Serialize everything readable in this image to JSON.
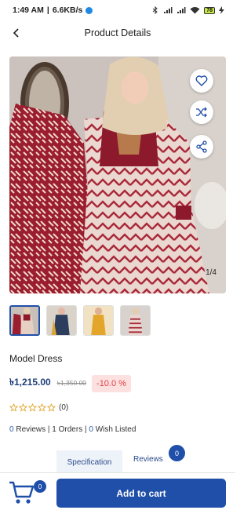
{
  "status_bar": {
    "time": "1:49 AM",
    "speed": "6.6KB/s",
    "battery": "78"
  },
  "header": {
    "title": "Product Details"
  },
  "gallery": {
    "counter": "1/4",
    "thumbnails": [
      {
        "name": "thumbnail-1"
      },
      {
        "name": "thumbnail-2"
      },
      {
        "name": "thumbnail-3"
      },
      {
        "name": "thumbnail-4"
      }
    ]
  },
  "product": {
    "name": "Model Dress",
    "price": "৳1,215.00",
    "old_price": "৳1,350.00",
    "discount": "-10.0 %",
    "rating_count": "(0)",
    "reviews_count": "0",
    "reviews_label": " Reviews | ",
    "orders_count": "1",
    "orders_label": " Orders | ",
    "wishlist_count": "0",
    "wishlist_label": " Wish Listed"
  },
  "tabs": {
    "specification": "Specification",
    "reviews": "Reviews",
    "reviews_badge": "0"
  },
  "bottom_bar": {
    "cart_badge": "0",
    "add_to_cart": "Add to cart"
  },
  "colors": {
    "primary": "#1f4fa8",
    "discount_bg": "#fde0e0",
    "discount_text": "#e04545"
  }
}
